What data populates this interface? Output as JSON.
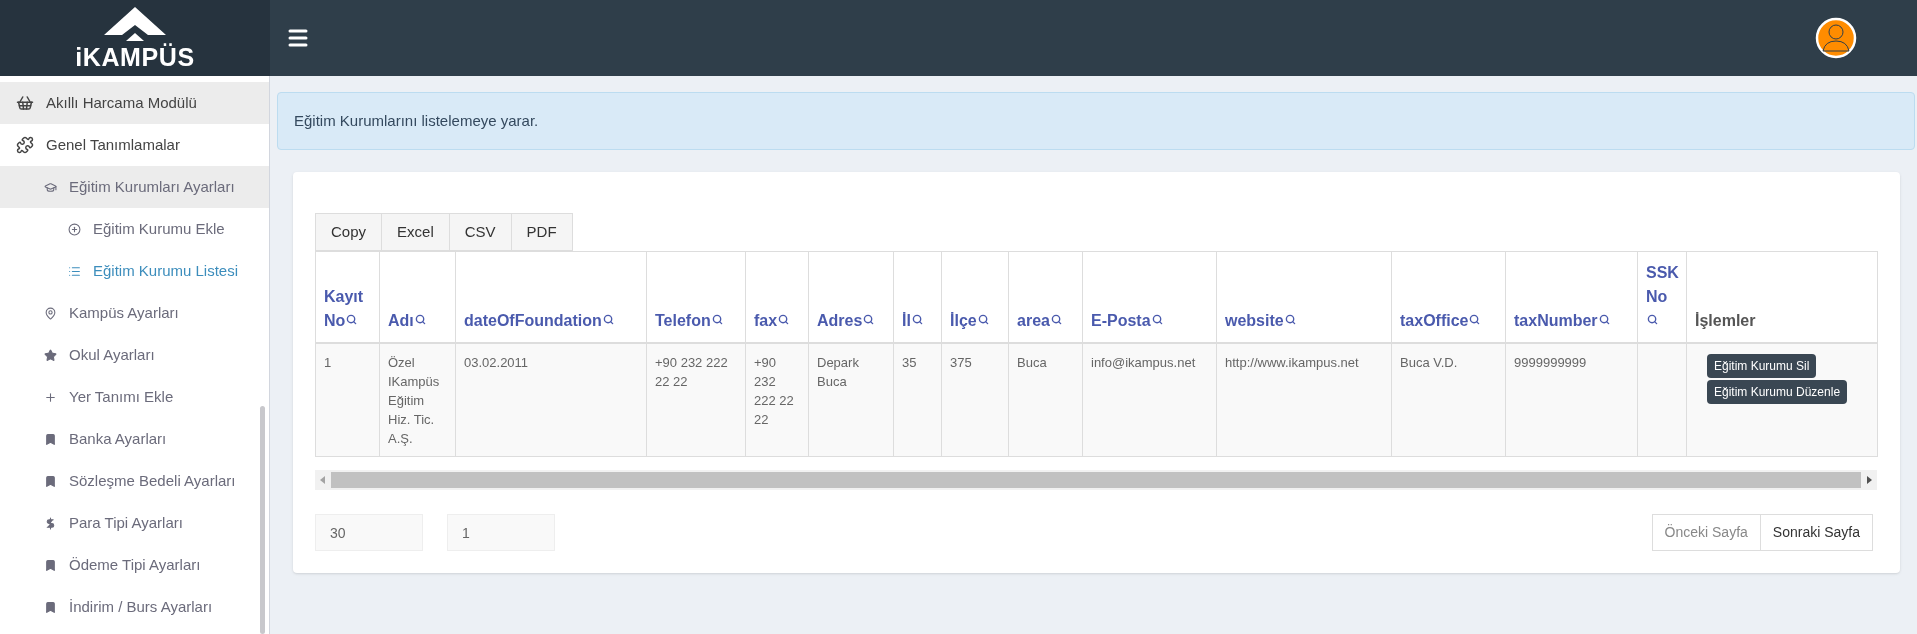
{
  "logo": {
    "text": "iKAMPÜS"
  },
  "sidebar": {
    "items": [
      {
        "label": "Akıllı Harcama Modülü",
        "highlighted": true
      },
      {
        "label": "Genel Tanımlamalar",
        "highlighted": false,
        "children": [
          {
            "label": "Eğitim Kurumları Ayarları",
            "highlighted": true,
            "children": [
              {
                "label": "Eğitim Kurumu Ekle",
                "selected": false
              },
              {
                "label": "Eğitim Kurumu Listesi",
                "selected": true
              }
            ]
          },
          {
            "label": "Kampüs Ayarları",
            "highlighted": false
          },
          {
            "label": "Okul Ayarları",
            "highlighted": false
          },
          {
            "label": "Yer Tanımı Ekle",
            "highlighted": false
          },
          {
            "label": "Banka Ayarları",
            "highlighted": false
          },
          {
            "label": "Sözleşme Bedeli Ayarları",
            "highlighted": false
          },
          {
            "label": "Para Tipi Ayarları",
            "highlighted": false
          },
          {
            "label": "Ödeme Tipi Ayarları",
            "highlighted": false
          },
          {
            "label": "İndirim / Burs Ayarları",
            "highlighted": false
          }
        ]
      }
    ]
  },
  "info": {
    "text": "Eğitim Kurumlarını listelemeye yarar."
  },
  "export_buttons": [
    "Copy",
    "Excel",
    "CSV",
    "PDF"
  ],
  "table": {
    "columns": [
      {
        "label": "Kayıt No",
        "searchable": true
      },
      {
        "label": "Adı",
        "searchable": true
      },
      {
        "label": "dateOfFoundation",
        "searchable": true
      },
      {
        "label": "Telefon",
        "searchable": true
      },
      {
        "label": "fax",
        "searchable": true
      },
      {
        "label": "Adres",
        "searchable": true
      },
      {
        "label": "İl",
        "searchable": true
      },
      {
        "label": "İlçe",
        "searchable": true
      },
      {
        "label": "area",
        "searchable": true
      },
      {
        "label": "E-Posta",
        "searchable": true
      },
      {
        "label": "website",
        "searchable": true
      },
      {
        "label": "taxOffice",
        "searchable": true
      },
      {
        "label": "taxNumber",
        "searchable": true
      },
      {
        "label": "SSK No",
        "searchable": true
      },
      {
        "label": "İşlemler",
        "searchable": false
      }
    ],
    "rows": [
      {
        "cells": [
          {
            "text": "1"
          },
          {
            "text": "Özel IKampüs Eğitim Hiz. Tic. A.Ş."
          },
          {
            "text": "03.02.2011"
          },
          {
            "text": "+90 232 222 22 22"
          },
          {
            "text": "+90 232 222 22 22"
          },
          {
            "text": "Depark Buca"
          },
          {
            "text": "35"
          },
          {
            "text": "375"
          },
          {
            "text": "Buca"
          },
          {
            "text": "info@ikampus.net"
          },
          {
            "text": "http://www.ikampus.net"
          },
          {
            "text": "Buca V.D."
          },
          {
            "text": "9999999999"
          },
          {}
        ],
        "actions": [
          "Eğitim Kurumu Sil",
          "Eğitim Kurumu Düzenle"
        ]
      }
    ]
  },
  "pagination": {
    "page_size": "30",
    "page": "1",
    "buttons": [
      {
        "label": "Önceki Sayfa",
        "disabled": true
      },
      {
        "label": "Sonraki Sayfa",
        "disabled": false
      }
    ]
  }
}
